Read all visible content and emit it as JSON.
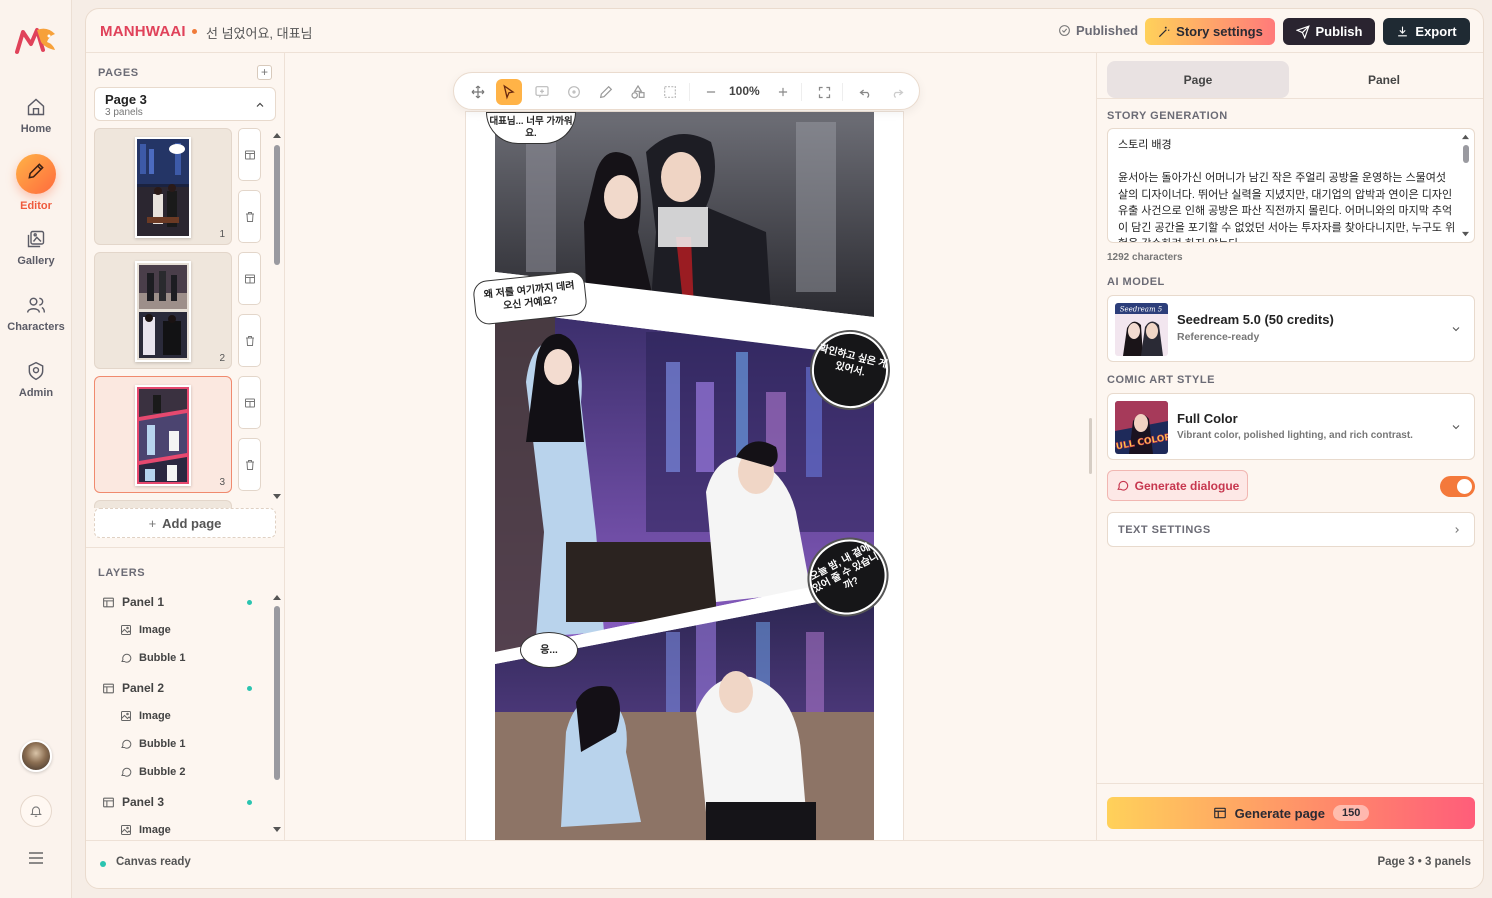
{
  "app": {
    "brand": "MANHWAAI",
    "document_title": "선 넘었어요, 대표님"
  },
  "colors": {
    "brand": "#e0425a",
    "accent_orange": "#f4793b",
    "teal_status": "#2bc4b0",
    "dark_button": "#2a2430"
  },
  "nav": {
    "items": [
      {
        "label": "Home",
        "icon": "home-icon"
      },
      {
        "label": "Editor",
        "icon": "pencil-icon",
        "active": true
      },
      {
        "label": "Gallery",
        "icon": "gallery-icon"
      },
      {
        "label": "Characters",
        "icon": "users-icon"
      },
      {
        "label": "Admin",
        "icon": "shield-icon"
      }
    ]
  },
  "header": {
    "published_label": "Published",
    "story_settings_label": "Story settings",
    "publish_label": "Publish",
    "export_label": "Export"
  },
  "pages": {
    "section_label": "PAGES",
    "selected": {
      "title": "Page 3",
      "subtitle": "3 panels"
    },
    "thumbnails": [
      {
        "number": "1"
      },
      {
        "number": "2"
      },
      {
        "number": "3",
        "selected": true
      }
    ],
    "add_page_label": "Add page"
  },
  "layers": {
    "section_label": "LAYERS",
    "items": [
      {
        "type": "panel",
        "label": "Panel 1"
      },
      {
        "type": "child",
        "label": "Image",
        "icon": "image-icon"
      },
      {
        "type": "child",
        "label": "Bubble 1",
        "icon": "bubble-icon"
      },
      {
        "type": "panel",
        "label": "Panel 2"
      },
      {
        "type": "child",
        "label": "Image",
        "icon": "image-icon"
      },
      {
        "type": "child",
        "label": "Bubble 1",
        "icon": "bubble-icon"
      },
      {
        "type": "child",
        "label": "Bubble 2",
        "icon": "bubble-icon"
      },
      {
        "type": "panel",
        "label": "Panel 3"
      },
      {
        "type": "child",
        "label": "Image",
        "icon": "image-icon"
      }
    ]
  },
  "toolbar": {
    "zoom": "100%",
    "tools": [
      "move-icon",
      "select-pointer-icon",
      "add-bubble-icon",
      "circle-icon",
      "pen-icon",
      "shapes-icon",
      "marquee-icon"
    ],
    "active_tool": "select-pointer-icon"
  },
  "comic": {
    "bubbles": [
      {
        "text": "대표님... 너무 가까워요."
      },
      {
        "text": "왜 저를 여기까지 데려오신 거예요?"
      },
      {
        "text": "확인하고 싶은 게 있어서."
      },
      {
        "text": "오늘 밤, 내 곁에 있어 줄 수 있습니까?"
      },
      {
        "text": "응..."
      }
    ]
  },
  "right_panel": {
    "tabs": [
      "Page",
      "Panel"
    ],
    "active_tab": "Page",
    "story_generation_label": "STORY GENERATION",
    "story_text": "스토리 배경\n\n윤서아는 돌아가신 어머니가 남긴 작은 주얼리 공방을 운영하는 스물여섯 살의 디자이너다. 뛰어난 실력을 지녔지만, 대기업의 압박과 연이은 디자인 유출 사건으로 인해 공방은 파산 직전까지 몰린다. 어머니와의 마지막 추억이 담긴 공간을 포기할 수 없었던 서아는 투자자를 찾아다니지만, 누구도 위험을 감수하려 하지 않는다.",
    "char_count": "1292 characters",
    "ai_model_label": "AI MODEL",
    "ai_model": {
      "name": "Seedream 5.0 (50 credits)",
      "sub": "Reference-ready",
      "thumb_caption": "Seedream 5"
    },
    "art_style_label": "COMIC ART STYLE",
    "art_style": {
      "name": "Full Color",
      "sub": "Vibrant color, polished lighting, and rich contrast.",
      "thumb_caption": "FULL COLOR"
    },
    "generate_dialogue_label": "Generate dialogue",
    "generate_dialogue_on": true,
    "text_settings_label": "TEXT SETTINGS",
    "generate_page_label": "Generate page",
    "generate_page_cost": "150"
  },
  "status": {
    "left": "Canvas ready",
    "right": "Page 3 • 3 panels"
  }
}
